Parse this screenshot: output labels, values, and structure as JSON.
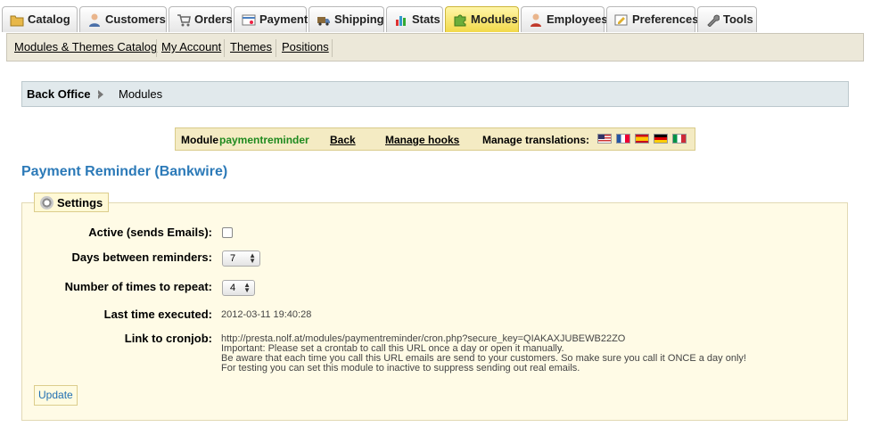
{
  "tabs": [
    {
      "label": "Catalog",
      "icon": "folder-icon",
      "active": false
    },
    {
      "label": "Customers",
      "icon": "user-icon",
      "active": false
    },
    {
      "label": "Orders",
      "icon": "cart-icon",
      "active": false
    },
    {
      "label": "Payment",
      "icon": "payment-card-icon",
      "active": false
    },
    {
      "label": "Shipping",
      "icon": "truck-icon",
      "active": false
    },
    {
      "label": "Stats",
      "icon": "bar-chart-icon",
      "active": false
    },
    {
      "label": "Modules",
      "icon": "puzzle-icon",
      "active": true
    },
    {
      "label": "Employees",
      "icon": "employee-icon",
      "active": false
    },
    {
      "label": "Preferences",
      "icon": "preferences-icon",
      "active": false
    },
    {
      "label": "Tools",
      "icon": "wrench-icon",
      "active": false
    }
  ],
  "subtabs": [
    "Modules & Themes Catalog",
    "My Account",
    "Themes",
    "Positions"
  ],
  "breadcrumb": {
    "root": "Back Office",
    "current": "Modules"
  },
  "module_bar": {
    "prefix": "Module",
    "module_name": "paymentreminder",
    "back": "Back",
    "manage_hooks": "Manage hooks",
    "manage_translations": "Manage translations:",
    "flags": [
      "us-flag-icon",
      "fr-flag-icon",
      "es-flag-icon",
      "de-flag-icon",
      "it-flag-icon"
    ]
  },
  "page_title": "Payment Reminder (Bankwire)",
  "settings": {
    "legend": "Settings",
    "active_label": "Active (sends Emails):",
    "active_checked": false,
    "days_label": "Days between reminders:",
    "days_value": "7",
    "repeat_label": "Number of times to repeat:",
    "repeat_value": "4",
    "last_label": "Last time executed:",
    "last_value": "2012-03-11 19:40:28",
    "cron_label": "Link to cronjob:",
    "cron_url": "http://presta.nolf.at/modules/paymentreminder/cron.php?secure_key=QIAKAXJUBEWB22ZO",
    "cron_note1": "Important: Please set a crontab to call this URL once a day or open it manually.",
    "cron_note2": "Be aware that each time you call this URL emails are send to your customers. So make sure you call it ONCE a day only!",
    "cron_note3": "For testing you can set this module to inactive to suppress sending out real emails.",
    "update_button": "Update"
  },
  "colors": {
    "accent": "#2c7ab8",
    "module_name": "#1f8a1f",
    "active_tab": "#f2d94a"
  }
}
